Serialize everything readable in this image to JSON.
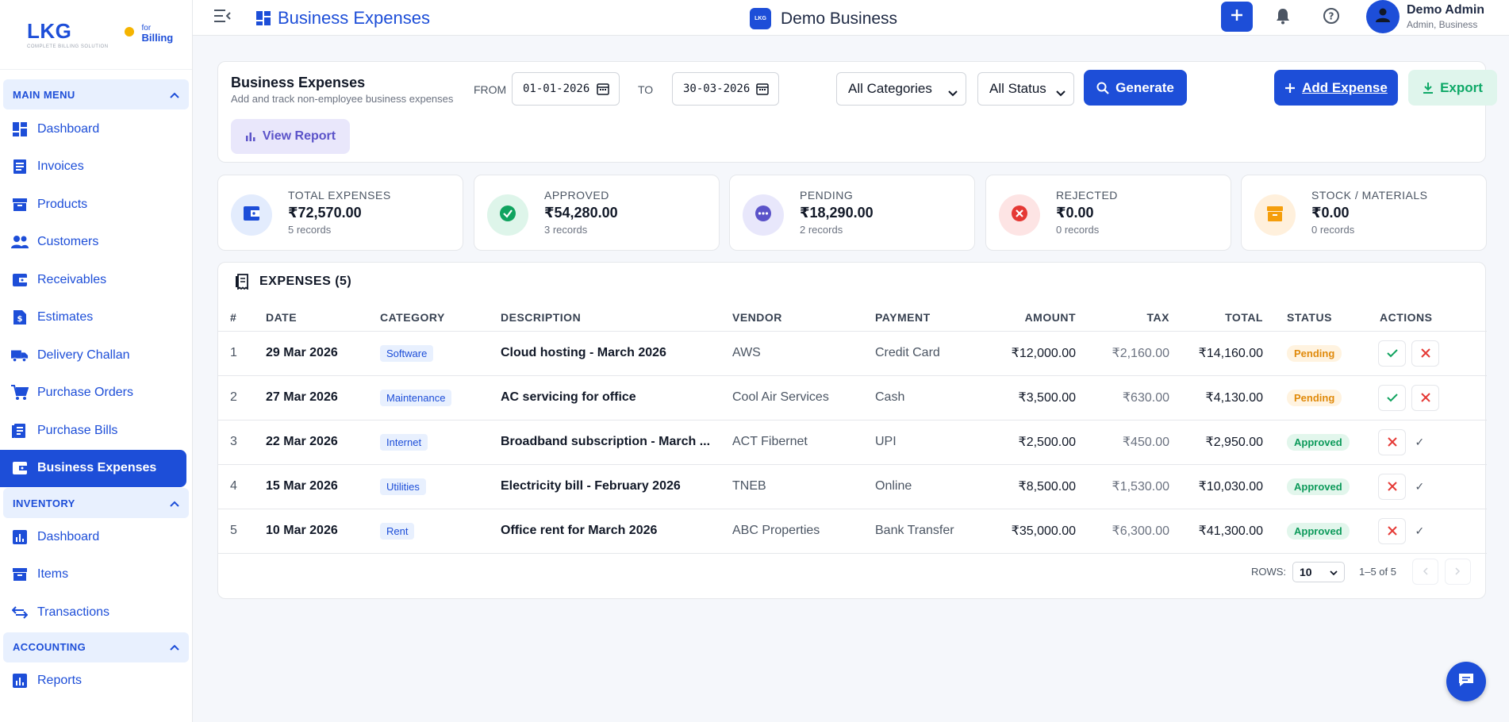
{
  "brand": {
    "logo_text": "LKG",
    "logo_tagline": "COMPLETE BILLING SOLUTION",
    "logo_for": "for",
    "logo_billing": "Billing",
    "color": "#1d4ed8"
  },
  "sidebar": {
    "sections": [
      {
        "title": "MAIN MENU",
        "items": [
          {
            "label": "Dashboard",
            "icon": "dashboard-icon"
          },
          {
            "label": "Invoices",
            "icon": "invoice-icon"
          },
          {
            "label": "Products",
            "icon": "product-icon"
          },
          {
            "label": "Customers",
            "icon": "customers-icon"
          },
          {
            "label": "Receivables",
            "icon": "wallet-icon"
          },
          {
            "label": "Estimates",
            "icon": "estimate-icon"
          },
          {
            "label": "Delivery Challan",
            "icon": "truck-icon"
          },
          {
            "label": "Purchase Orders",
            "icon": "cart-icon"
          },
          {
            "label": "Purchase Bills",
            "icon": "bill-icon"
          },
          {
            "label": "Business Expenses",
            "icon": "wallet-icon",
            "active": true
          }
        ]
      },
      {
        "title": "INVENTORY",
        "items": [
          {
            "label": "Dashboard",
            "icon": "chart-icon"
          },
          {
            "label": "Items",
            "icon": "box-icon"
          },
          {
            "label": "Transactions",
            "icon": "swap-icon"
          }
        ]
      },
      {
        "title": "ACCOUNTING",
        "items": [
          {
            "label": "Reports",
            "icon": "chart-icon"
          }
        ]
      }
    ]
  },
  "topbar": {
    "page_title": "Business Expenses",
    "business_name": "Demo Business",
    "business_logo_text": "LKG",
    "user_name": "Demo Admin",
    "user_role": "Admin, Business"
  },
  "filters": {
    "title": "Business Expenses",
    "subtitle": "Add and track non-employee business expenses",
    "from_label": "FROM",
    "from_value": "01-01-2026",
    "to_label": "TO",
    "to_value": "30-03-2026",
    "category_selected": "All Categories",
    "status_selected": "All Status",
    "generate_label": "Generate",
    "add_label": "Add Expense",
    "export_label": "Export",
    "view_report_label": "View Report"
  },
  "stats": [
    {
      "label": "TOTAL EXPENSES",
      "value": "₹72,570.00",
      "count": "5 records",
      "icon": "wallet-icon",
      "bg": "#e3ecfd",
      "fg": "#1d4ed8"
    },
    {
      "label": "APPROVED",
      "value": "₹54,280.00",
      "count": "3 records",
      "icon": "check-circle-icon",
      "bg": "#def5ea",
      "fg": "#10a35f"
    },
    {
      "label": "PENDING",
      "value": "₹18,290.00",
      "count": "2 records",
      "icon": "pending-icon",
      "bg": "#e8e7fb",
      "fg": "#5b53c9"
    },
    {
      "label": "REJECTED",
      "value": "₹0.00",
      "count": "0 records",
      "icon": "x-circle-icon",
      "bg": "#fde4e4",
      "fg": "#e53935"
    },
    {
      "label": "STOCK / MATERIALS",
      "value": "₹0.00",
      "count": "0 records",
      "icon": "archive-icon",
      "bg": "#fff0dc",
      "fg": "#f59e0b"
    }
  ],
  "table": {
    "title": "EXPENSES (5)",
    "columns": [
      "#",
      "DATE",
      "CATEGORY",
      "DESCRIPTION",
      "VENDOR",
      "PAYMENT",
      "AMOUNT",
      "TAX",
      "TOTAL",
      "STATUS",
      "ACTIONS"
    ],
    "rows": [
      {
        "num": "1",
        "date": "29 Mar 2026",
        "category": "Software",
        "description": "Cloud hosting - March 2026",
        "vendor": "AWS",
        "payment": "Credit Card",
        "amount": "₹12,000.00",
        "tax": "₹2,160.00",
        "total": "₹14,160.00",
        "status": "Pending"
      },
      {
        "num": "2",
        "date": "27 Mar 2026",
        "category": "Maintenance",
        "description": "AC servicing for office",
        "vendor": "Cool Air Services",
        "payment": "Cash",
        "amount": "₹3,500.00",
        "tax": "₹630.00",
        "total": "₹4,130.00",
        "status": "Pending"
      },
      {
        "num": "3",
        "date": "22 Mar 2026",
        "category": "Internet",
        "description": "Broadband subscription - March ...",
        "vendor": "ACT Fibernet",
        "payment": "UPI",
        "amount": "₹2,500.00",
        "tax": "₹450.00",
        "total": "₹2,950.00",
        "status": "Approved"
      },
      {
        "num": "4",
        "date": "15 Mar 2026",
        "category": "Utilities",
        "description": "Electricity bill - February 2026",
        "vendor": "TNEB",
        "payment": "Online",
        "amount": "₹8,500.00",
        "tax": "₹1,530.00",
        "total": "₹10,030.00",
        "status": "Approved"
      },
      {
        "num": "5",
        "date": "10 Mar 2026",
        "category": "Rent",
        "description": "Office rent for March 2026",
        "vendor": "ABC Properties",
        "payment": "Bank Transfer",
        "amount": "₹35,000.00",
        "tax": "₹6,300.00",
        "total": "₹41,300.00",
        "status": "Approved"
      }
    ],
    "approved_mark": "✓"
  },
  "pagination": {
    "rows_label": "ROWS:",
    "rows_value": "10",
    "range": "1–5 of 5"
  }
}
